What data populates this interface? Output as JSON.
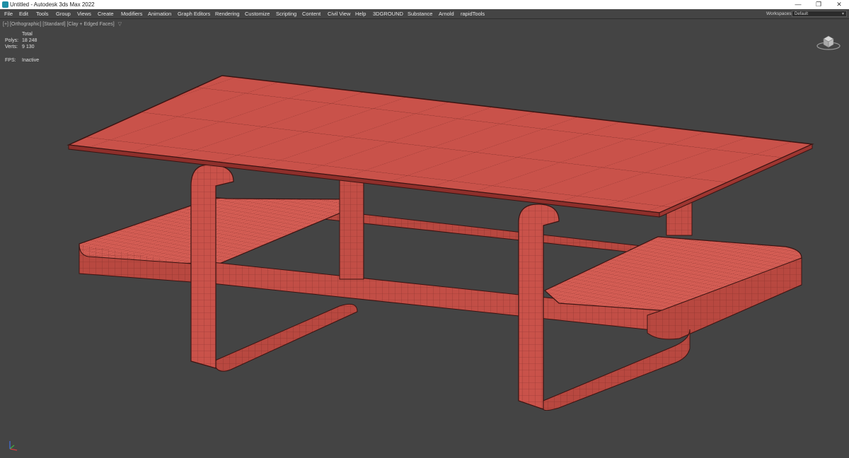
{
  "window": {
    "title": "Untitled - Autodesk 3ds Max 2022",
    "minimize_glyph": "—",
    "restore_glyph": "❐",
    "close_glyph": "✕"
  },
  "menu": {
    "items": [
      "File",
      "Edit",
      "Tools",
      "Group",
      "Views",
      "Create",
      "Modifiers",
      "Animation",
      "Graph Editors",
      "Rendering",
      "Customize",
      "Scripting",
      "Content",
      "Civil View",
      "Help",
      "3DGROUND",
      "Substance",
      "Arnold",
      "rapidTools"
    ],
    "workspaces_label": "Workspaces:",
    "workspace_value": "Default"
  },
  "viewport": {
    "label_plus": "[+]",
    "label_view": "[Orthographic]",
    "label_shading": "[Standard]",
    "label_mode": "[Clay + Edged Faces]",
    "filter_icon": "filter-icon",
    "stats": {
      "header": "Total",
      "polys_label": "Polys:",
      "polys_value": "18 248",
      "verts_label": "Verts:",
      "verts_value": "9 130",
      "fps_label": "FPS:",
      "fps_value": "Inactive"
    }
  },
  "colors": {
    "viewport_bg": "#444444",
    "clay_face": "#c9524a",
    "clay_light": "#d45d54",
    "clay_dark": "#8e2f2b",
    "edge": "#3b1412"
  }
}
